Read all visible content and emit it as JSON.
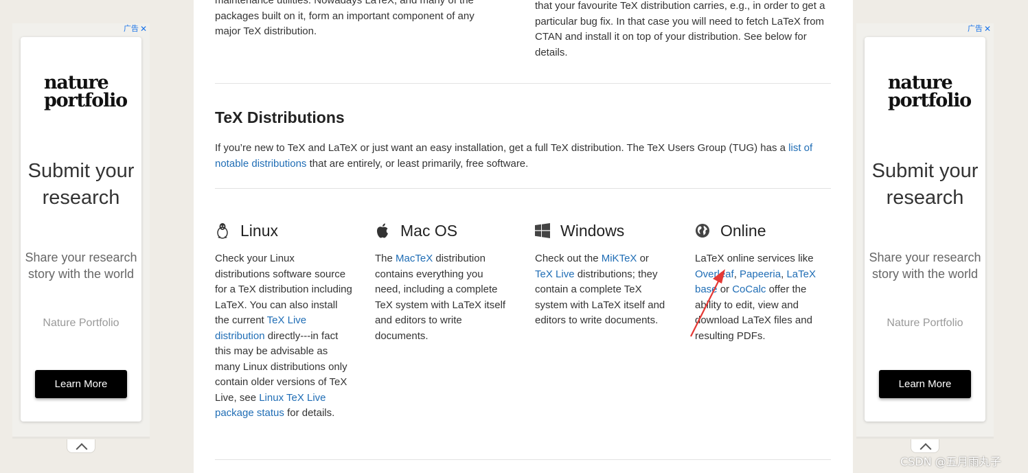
{
  "ads": {
    "tag_label": "广告",
    "close_glyph": "✕",
    "logo_line1": "nature",
    "logo_line2": "portfolio",
    "headline": "Submit your research",
    "subline": "Share your research story with the world",
    "brand": "Nature Portfolio",
    "cta_label": "Learn More"
  },
  "top_text": {
    "left": "maintenance utilities. Nowadays LaTeX, and many of the packages built on it, form an important component of any major TeX distribution.",
    "right": "that your favourite TeX distribution carries, e.g., in order to get a particular bug fix. In that case you will need to fetch LaTeX from CTAN and install it on top of your distribution. See below for details."
  },
  "distributions": {
    "title": "TeX Distributions",
    "intro_before": "If you’re new to TeX and LaTeX or just want an easy installation, get a full TeX distribution. The TeX Users Group (TUG) has a ",
    "intro_link": "list of notable distributions",
    "intro_after": " that are entirely, or least primarily, free software."
  },
  "columns": {
    "linux": {
      "title": "Linux",
      "icon": "tux-penguin-icon",
      "t1": "Check your Linux distributions software source for a TeX distribution including LaTeX. You can also install the current ",
      "l1": "TeX Live distribution",
      "t2": " directly---in fact this may be advisable as many Linux distributions only contain older versions of TeX Live, see ",
      "l2": "Linux TeX Live package status",
      "t3": " for details."
    },
    "mac": {
      "title": "Mac OS",
      "icon": "apple-icon",
      "t1": "The ",
      "l1": "MacTeX",
      "t2": " distribution contains everything you need, including a complete TeX system with LaTeX itself and editors to write documents."
    },
    "windows": {
      "title": "Windows",
      "icon": "windows-logo-icon",
      "t1": "Check out the ",
      "l1": "MiKTeX",
      "t2": " or ",
      "l2": "TeX Live",
      "t3": " distributions; they contain a complete TeX system with LaTeX itself and editors to write documents."
    },
    "online": {
      "title": "Online",
      "icon": "globe-icon",
      "t1": "LaTeX online services like ",
      "l1": "Overleaf",
      "t2": ", ",
      "l2": "Papeeria",
      "t3": ", ",
      "l3": "LaTeX base",
      "t4": " or ",
      "l4": "CoCalc",
      "t5": " offer the ability to edit, view and download LaTeX files and resulting PDFs."
    }
  },
  "annotation": {
    "color": "#e53935"
  },
  "watermark": "CSDN @五月雨丸子"
}
